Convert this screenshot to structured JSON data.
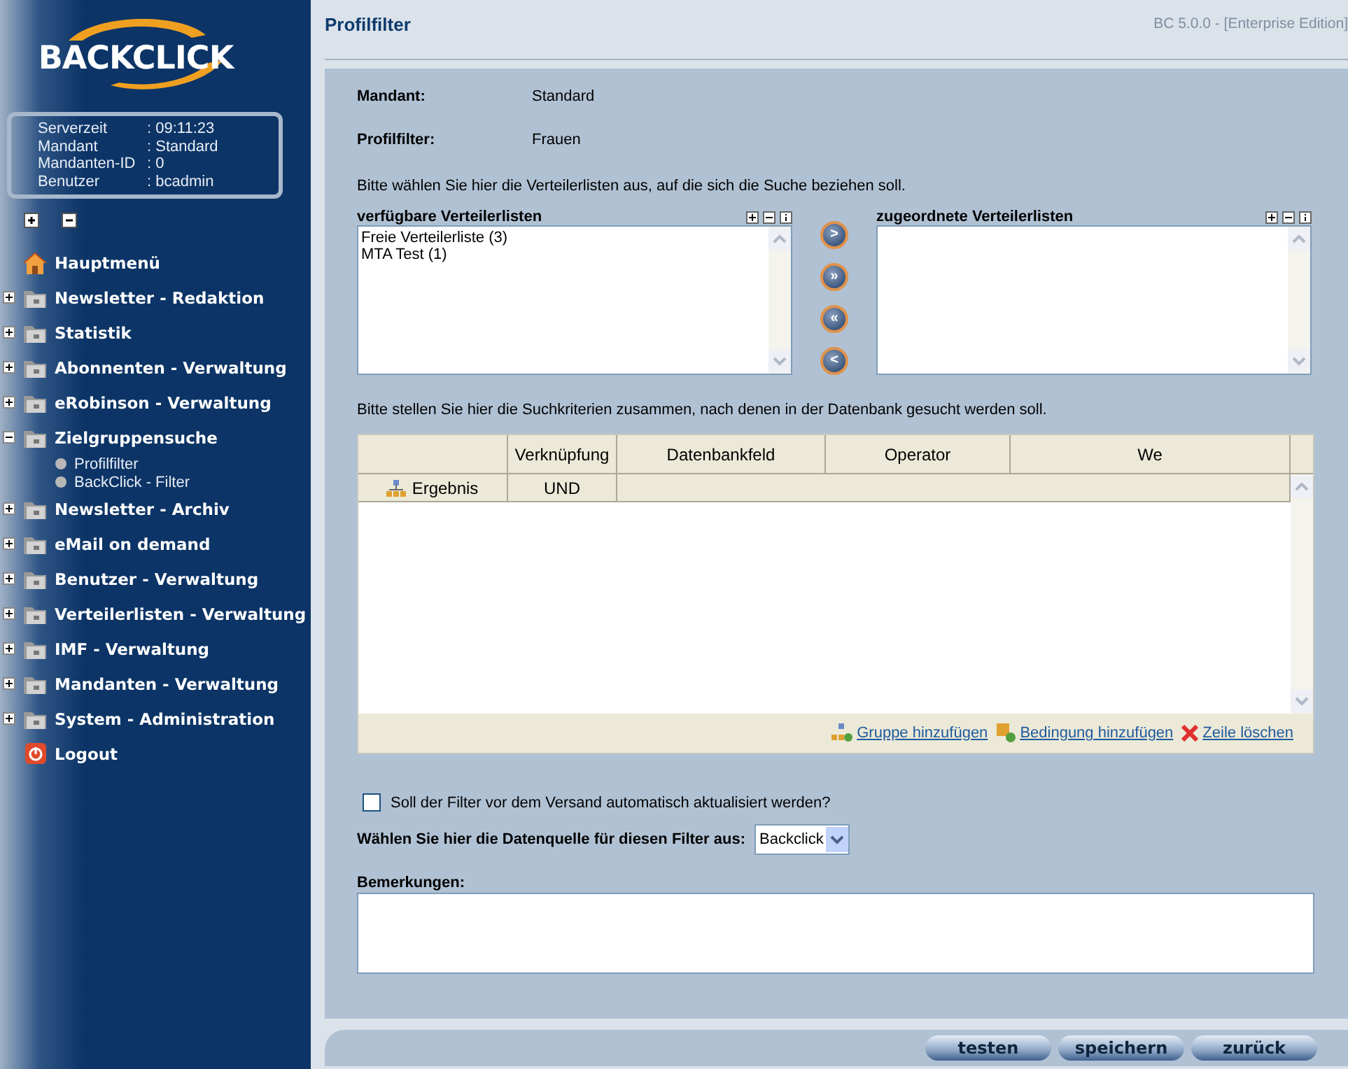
{
  "logo": {
    "text": "BACKCLICK"
  },
  "info": [
    {
      "label": "Serverzeit",
      "value": ": 09:11:23"
    },
    {
      "label": "Mandant",
      "value": ": Standard"
    },
    {
      "label": "Mandanten-ID",
      "value": ": 0"
    },
    {
      "label": "Benutzer",
      "value": ": bcadmin"
    }
  ],
  "menu": [
    {
      "kind": "home",
      "label": "Hauptmenü"
    },
    {
      "kind": "folder",
      "label": "Newsletter - Redaktion",
      "expanded": false
    },
    {
      "kind": "folder",
      "label": "Statistik",
      "expanded": false
    },
    {
      "kind": "folder",
      "label": "Abonnenten - Verwaltung",
      "expanded": false
    },
    {
      "kind": "folder",
      "label": "eRobinson - Verwaltung",
      "expanded": false
    },
    {
      "kind": "folder",
      "label": "Zielgruppensuche",
      "expanded": true,
      "children": [
        {
          "label": "Profilfilter"
        },
        {
          "label": "BackClick - Filter"
        }
      ]
    },
    {
      "kind": "folder",
      "label": "Newsletter - Archiv",
      "expanded": false
    },
    {
      "kind": "folder",
      "label": "eMail on demand",
      "expanded": false
    },
    {
      "kind": "folder",
      "label": "Benutzer - Verwaltung",
      "expanded": false
    },
    {
      "kind": "folder",
      "label": "Verteilerlisten - Verwaltung",
      "expanded": false
    },
    {
      "kind": "folder",
      "label": "IMF - Verwaltung",
      "expanded": false
    },
    {
      "kind": "folder",
      "label": "Mandanten - Verwaltung",
      "expanded": false
    },
    {
      "kind": "folder",
      "label": "System - Administration",
      "expanded": false
    },
    {
      "kind": "logout",
      "label": "Logout"
    }
  ],
  "header": {
    "title": "Profilfilter",
    "version": "BC 5.0.0 - [Enterprise Edition]"
  },
  "fields": [
    {
      "label": "Mandant:",
      "value": "Standard"
    },
    {
      "label": "Profilfilter:",
      "value": "Frauen"
    }
  ],
  "lists_hint": "Bitte wählen Sie hier die Verteilerlisten aus, auf die sich die Suche beziehen soll.",
  "available": {
    "title": "verfügbare Verteilerlisten",
    "items": [
      "Freie Verteilerliste (3)",
      "MTA Test (1)"
    ]
  },
  "move_buttons": [
    ">",
    "»",
    "«",
    "<"
  ],
  "assigned": {
    "title": "zugeordnete Verteilerlisten"
  },
  "criteria_hint": "Bitte stellen Sie hier die Suchkriterien zusammen, nach denen in der Datenbank gesucht werden soll.",
  "table": {
    "columns": [
      "",
      "Verknüpfung",
      "Datenbankfeld",
      "Operator",
      "We"
    ],
    "rows": [
      {
        "name": "Ergebnis",
        "link": "UND"
      }
    ]
  },
  "table_actions": [
    {
      "kind": "group",
      "label": "Gruppe hinzufügen"
    },
    {
      "kind": "condition",
      "label": "Bedingung hinzufügen"
    },
    {
      "kind": "delete",
      "label": "Zeile löschen"
    }
  ],
  "auto_update": {
    "label": "Soll der Filter vor dem Versand automatisch aktualisiert werden?",
    "checked": false
  },
  "source": {
    "label": "Wählen Sie hier die Datenquelle für diesen Filter aus:",
    "value": "Backclick"
  },
  "remarks": {
    "label": "Bemerkungen:"
  },
  "buttons": [
    "testen",
    "speichern",
    "zurück"
  ]
}
